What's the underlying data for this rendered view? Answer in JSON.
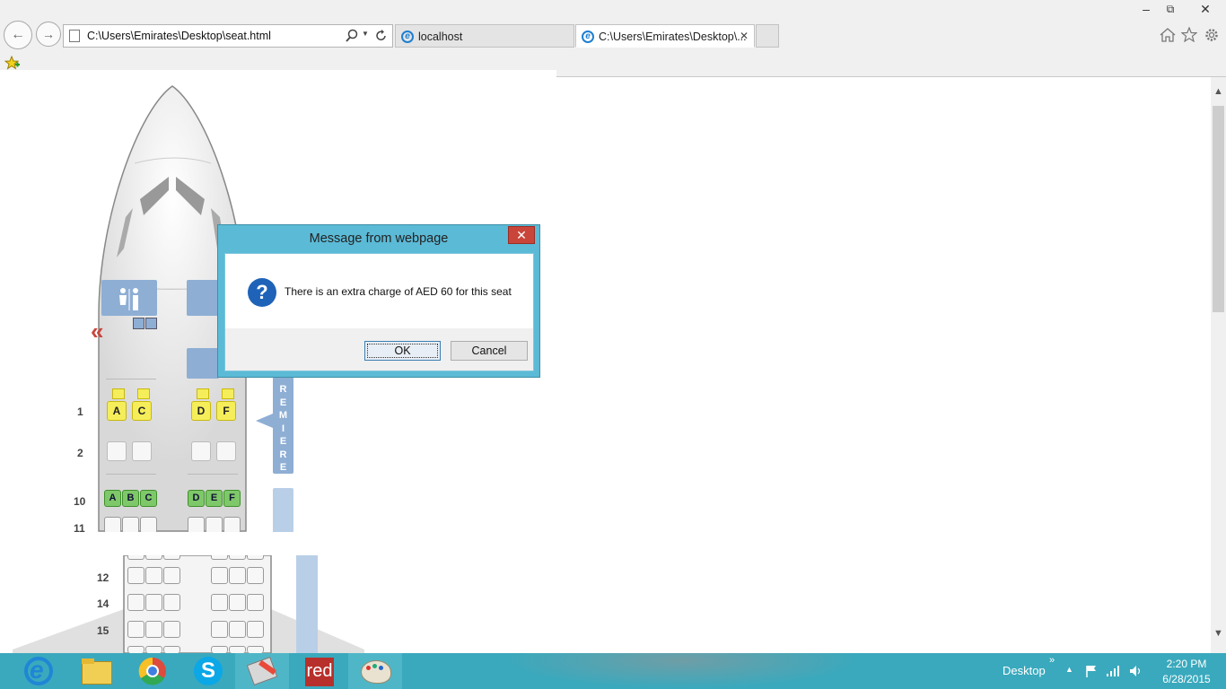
{
  "window": {
    "minimize": "–",
    "restore": "⧉",
    "close": "✕"
  },
  "browser": {
    "address": "C:\\Users\\Emirates\\Desktop\\seat.html",
    "tabs": [
      {
        "label": "localhost"
      },
      {
        "label": "C:\\Users\\Emirates\\Desktop\\...",
        "close": "✕"
      }
    ],
    "icons": [
      "back-icon",
      "forward-icon",
      "search-icon",
      "refresh-icon",
      "home-icon",
      "favorites-star-icon",
      "settings-gear-icon",
      "favorites-bar-icon"
    ]
  },
  "seatmap": {
    "back_arrow": "«",
    "cabin_label_letters": [
      "R",
      "E",
      "M",
      "I",
      "E",
      "R",
      "E"
    ],
    "rows": [
      {
        "num": "1",
        "left": [
          "A",
          "C"
        ],
        "right": [
          "D",
          "F"
        ],
        "status": "selected-yellow"
      },
      {
        "num": "2",
        "left": [
          "",
          ""
        ],
        "right": [
          "",
          ""
        ],
        "status": "empty"
      },
      {
        "num": "10",
        "left": [
          "A",
          "B",
          "C"
        ],
        "right": [
          "D",
          "E",
          "F"
        ],
        "status": "available-green"
      },
      {
        "num": "11",
        "status": "empty"
      },
      {
        "num": "12",
        "status": "empty"
      },
      {
        "num": "14",
        "status": "empty"
      },
      {
        "num": "15",
        "status": "empty"
      }
    ]
  },
  "dialog": {
    "title": "Message from webpage",
    "close": "✕",
    "icon": "question-icon",
    "icon_glyph": "?",
    "message": "There is an extra charge of AED 60 for this seat",
    "ok_label": "OK",
    "cancel_label": "Cancel"
  },
  "taskbar": {
    "apps": [
      "internet-explorer-icon",
      "file-explorer-icon",
      "chrome-icon",
      "skype-icon",
      "tools-icon",
      "red-app-icon",
      "paint-icon"
    ],
    "red_app_label": "red",
    "desktop_label": "Desktop",
    "overflow": "»",
    "time": "2:20 PM",
    "date": "6/28/2015"
  }
}
